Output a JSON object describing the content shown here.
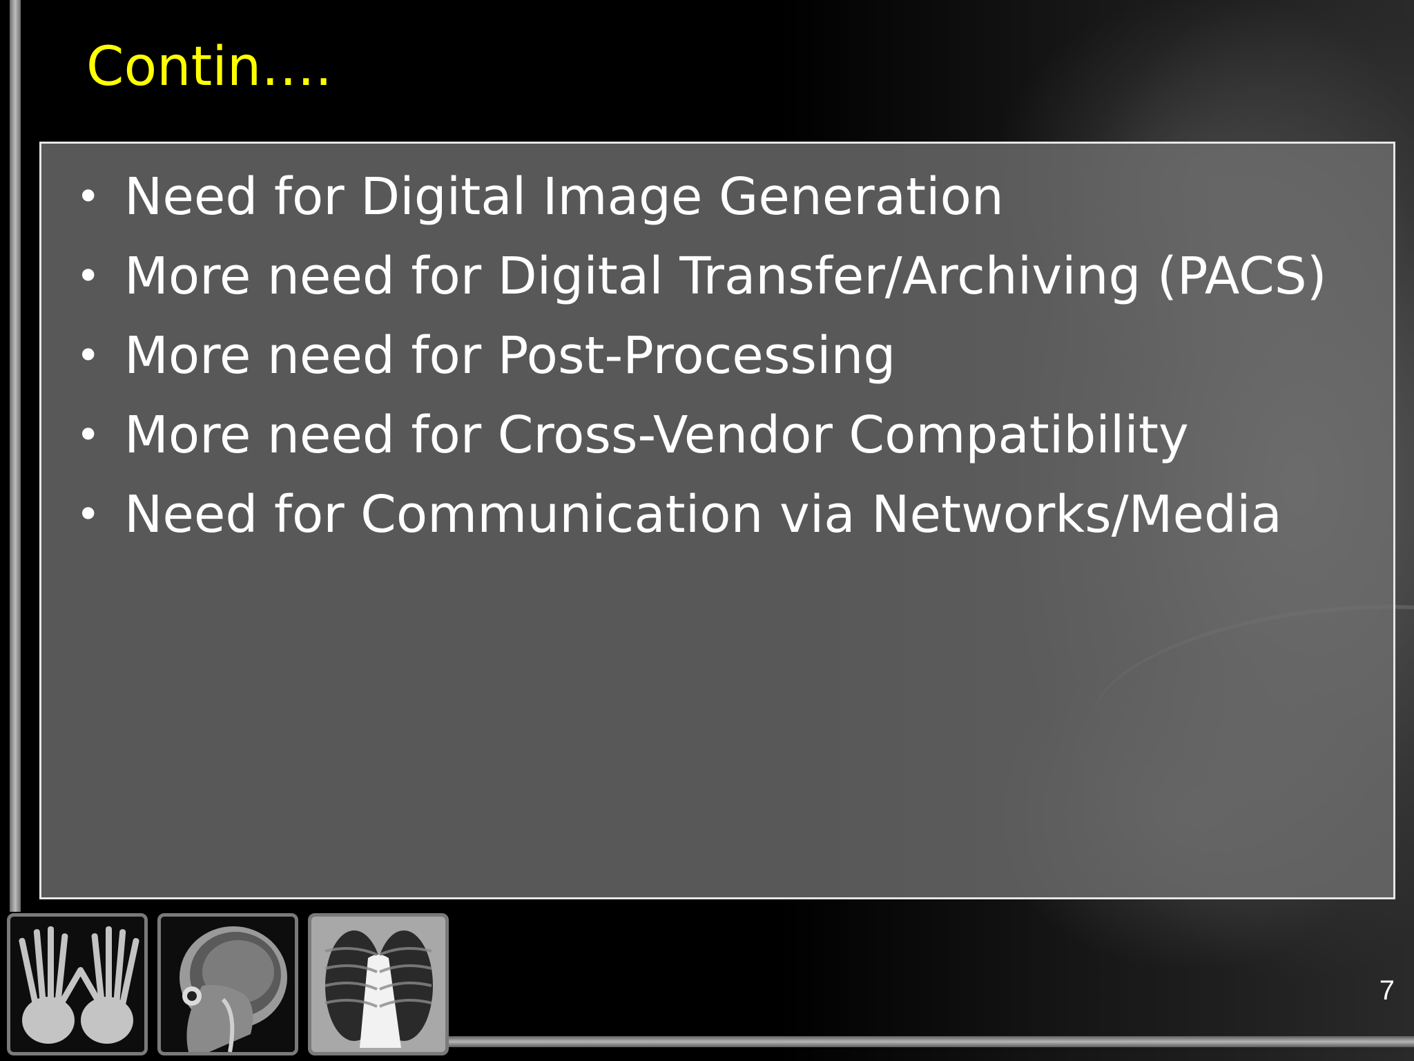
{
  "slide": {
    "title": "Contin….",
    "bullets": [
      "Need for Digital Image Generation",
      "More need for Digital Transfer/Archiving (PACS)",
      "More need for Post-Processing",
      "More need for Cross-Vendor Compatibility",
      "Need for Communication via Networks/Media"
    ],
    "bullet_glyph": "•",
    "page_number": "7",
    "thumbnails": [
      "hand-xray-icon",
      "head-mri-icon",
      "chest-xray-icon"
    ]
  },
  "colors": {
    "background": "#000000",
    "title": "#ffff00",
    "text": "#ffffff",
    "content_box": "#6e6e6e",
    "content_border": "#e6e6e6"
  }
}
